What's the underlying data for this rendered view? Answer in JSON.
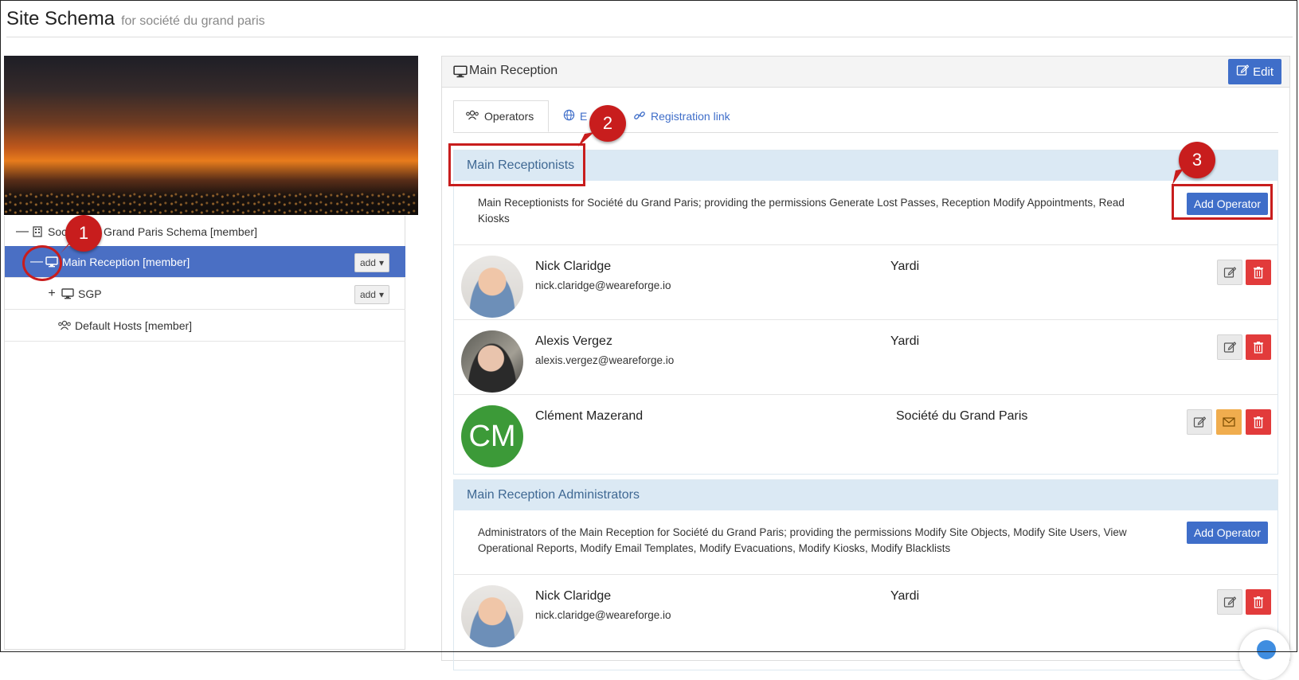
{
  "header": {
    "title": "Site Schema",
    "subtitle": "for société du grand paris"
  },
  "tree": {
    "items": [
      {
        "label": "Société du Grand Paris Schema [member]",
        "toggle": "—"
      },
      {
        "label": "Main Reception [member]",
        "toggle": "—",
        "add_label": "add"
      },
      {
        "label": "SGP",
        "toggle": "+",
        "add_label": "add"
      },
      {
        "label": "Default Hosts [member]"
      }
    ]
  },
  "panel": {
    "title": "Main Reception",
    "edit_label": "Edit",
    "tabs": [
      {
        "label": "Operators"
      },
      {
        "label": "E"
      },
      {
        "label": "Registration link"
      }
    ]
  },
  "groups": [
    {
      "title": "Main Receptionists",
      "description": "Main Receptionists for Société du Grand Paris; providing the permissions Generate Lost Passes, Reception Modify Appointments, Read Kiosks",
      "add_label": "Add Operator",
      "members": [
        {
          "name": "Nick Claridge",
          "email": "nick.claridge@weareforge.io",
          "org": "Yardi"
        },
        {
          "name": "Alexis Vergez",
          "email": "alexis.vergez@weareforge.io",
          "org": "Yardi"
        },
        {
          "name": "Clément Mazerand",
          "email": "",
          "org": "Société du Grand Paris",
          "initials": "CM"
        }
      ]
    },
    {
      "title": "Main Reception Administrators",
      "description": "Administrators of the Main Reception for Société du Grand Paris; providing the permissions Modify Site Objects, Modify Site Users, View Operational Reports, Modify Email Templates, Modify Evacuations, Modify Kiosks, Modify Blacklists",
      "add_label": "Add Operator",
      "members": [
        {
          "name": "Nick Claridge",
          "email": "nick.claridge@weareforge.io",
          "org": "Yardi"
        }
      ]
    }
  ],
  "annotations": {
    "badge_1": "1",
    "badge_2": "2",
    "badge_3": "3"
  },
  "colors": {
    "primary": "#3f6ec9",
    "danger": "#e23b3b",
    "warning": "#f0ad4e",
    "annotation": "#c81d1d",
    "selected_row": "#4a6fc4"
  }
}
